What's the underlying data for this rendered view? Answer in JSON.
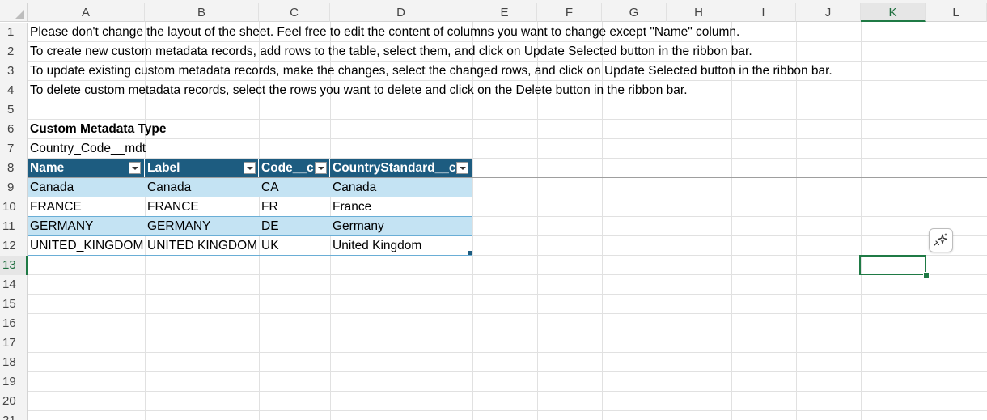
{
  "columns": [
    "A",
    "B",
    "C",
    "D",
    "E",
    "F",
    "G",
    "H",
    "I",
    "J",
    "K",
    "L"
  ],
  "rows": [
    "1",
    "2",
    "3",
    "4",
    "5",
    "6",
    "7",
    "8",
    "9",
    "10",
    "11",
    "12",
    "13",
    "14",
    "15",
    "16",
    "17",
    "18",
    "19",
    "20",
    "21"
  ],
  "instructions": [
    "Please don't change the layout of the sheet. Feel free to edit the content of columns you want to change except \"Name\" column.",
    "To create new custom metadata records, add rows to the table, select them, and click on Update Selected button in the ribbon bar.",
    "To update existing custom metadata records, make the changes, select the changed rows, and click on Update Selected button in the ribbon bar.",
    "To delete custom metadata records, select the rows you want to delete and click on the Delete button in the ribbon bar."
  ],
  "metadata_type_label": "Custom Metadata Type",
  "metadata_type_value": "Country_Code__mdt",
  "table": {
    "headers": [
      "Name",
      "Label",
      "Code__c",
      "CountryStandard__c"
    ],
    "rows": [
      [
        "Canada",
        "Canada",
        "CA",
        "Canada"
      ],
      [
        "FRANCE",
        "FRANCE",
        "FR",
        "France"
      ],
      [
        "GERMANY",
        "GERMANY",
        "DE",
        "Germany"
      ],
      [
        "UNITED_KINGDOM",
        "UNITED KINGDOM",
        "UK",
        "United Kingdom"
      ]
    ]
  },
  "selected_cell": "K13",
  "colors": {
    "table_header": "#1d5c80",
    "band": "#c4e3f3",
    "selection": "#1f7a45"
  },
  "icons": {
    "copilot": "sparkle-icon",
    "filter": "chevron-down-icon"
  }
}
